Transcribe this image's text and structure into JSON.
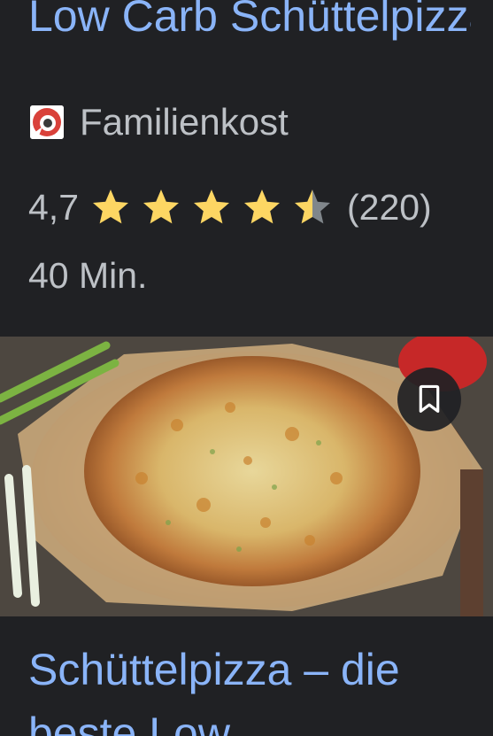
{
  "card1": {
    "title": "Low Carb Schüttelpizza",
    "source": "Familienkost",
    "favicon": "familienkost-logo",
    "rating_value": "4,7",
    "rating_stars": 4.5,
    "rating_count": "(220)",
    "time": "40 Min."
  },
  "card2": {
    "image": "pizza-photo",
    "save_icon": "bookmark-icon",
    "title": "Schüttelpizza – die beste Low"
  },
  "colors": {
    "background": "#202124",
    "link": "#8ab4f8",
    "text": "#bdc1c6",
    "star": "#fdd663",
    "star_empty": "#80868b"
  }
}
